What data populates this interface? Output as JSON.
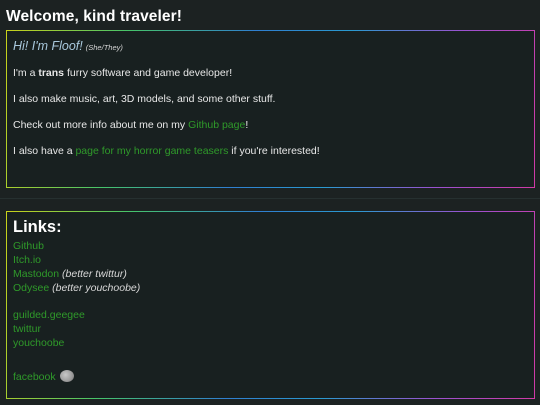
{
  "header": {
    "title": "Welcome, kind traveler!"
  },
  "intro": {
    "greeting": "Hi! I'm Floof!",
    "pronouns": "(She/They)",
    "line1_pre": "I'm a ",
    "line1_bold": "trans",
    "line1_post": " furry software and game developer!",
    "line2": "I also make music, art, 3D models, and some other stuff.",
    "line3_pre": "Check out more info about me on my ",
    "line3_link": "Github page",
    "line3_post": "!",
    "line4_pre": "I also have a ",
    "line4_link": "page for my horror game teasers",
    "line4_post": " if you're interested!"
  },
  "links": {
    "title": "Links:",
    "github": "Github",
    "itch": "Itch.io",
    "mastodon": "Mastodon",
    "mastodon_note": "(better twittur)",
    "odysee": "Odysee",
    "odysee_note": "(better youchoobe)",
    "guilded": "guilded.geegee",
    "twittur": "twittur",
    "youchoobe": "youchoobe",
    "facebook": "facebook",
    "facebook_icon": "trollface-icon"
  },
  "colors": {
    "background": "#1c2222",
    "link": "#2f9a2a",
    "greeting": "#a9c9dd"
  }
}
